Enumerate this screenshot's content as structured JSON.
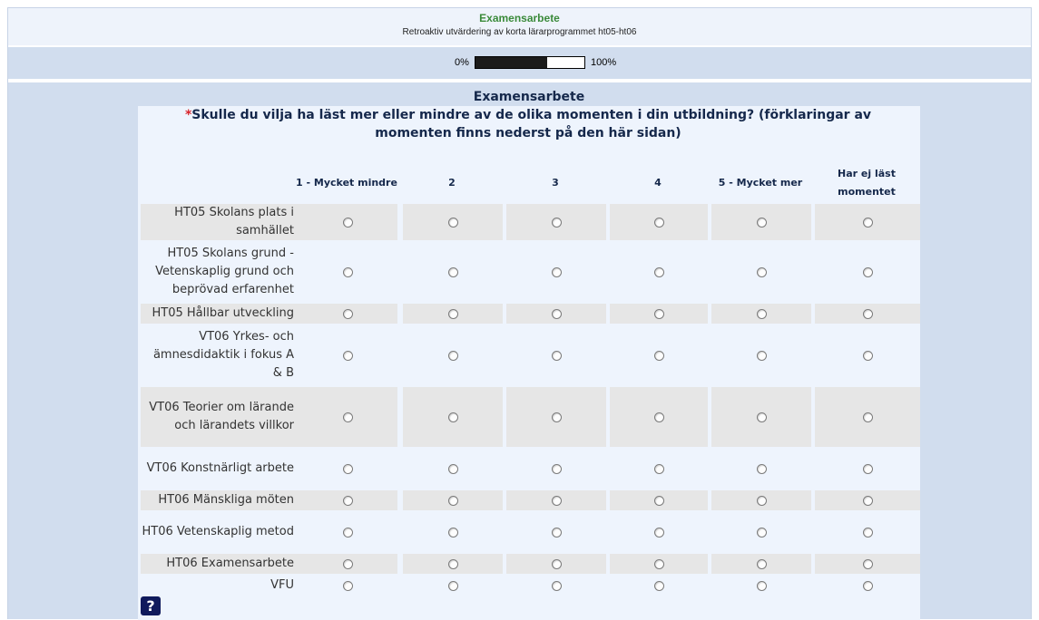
{
  "header": {
    "title": "Examensarbete",
    "subtitle": "Retroaktiv utvärdering av korta lärarprogrammet ht05-ht06"
  },
  "progress": {
    "min_label": "0%",
    "max_label": "100%",
    "value_fraction": 0.66
  },
  "section": {
    "title": "Examensarbete"
  },
  "question": {
    "required_marker": "*",
    "text": "Skulle du vilja ha läst mer eller mindre av de olika momenten i din utbildning? (förklaringar av momenten finns nederst på den här sidan)"
  },
  "columns": [
    "1 - Mycket mindre",
    "2",
    "3",
    "4",
    "5 - Mycket mer",
    "Har ej läst momentet"
  ],
  "rows": [
    "HT05 Skolans plats i samhället",
    "HT05 Skolans grund - Vetenskaplig grund och beprövad erfarenhet",
    "HT05 Hållbar utveckling",
    "VT06 Yrkes- och ämnesdidaktik i fokus A & B",
    "VT06 Teorier om lärande och lärandets villkor",
    "VT06 Konstnärligt arbete",
    "HT06 Mänskliga möten",
    "HT06 Vetenskaplig metod",
    "HT06 Examensarbete",
    "VFU"
  ],
  "help": {
    "label": "?",
    "icon": "help-icon"
  },
  "colors": {
    "title_green": "#3a8a3a",
    "heading_navy": "#15284b",
    "required_red": "#d8232a",
    "panel_blue": "#d1ddee",
    "shaded_row": "#e6e6e6"
  }
}
